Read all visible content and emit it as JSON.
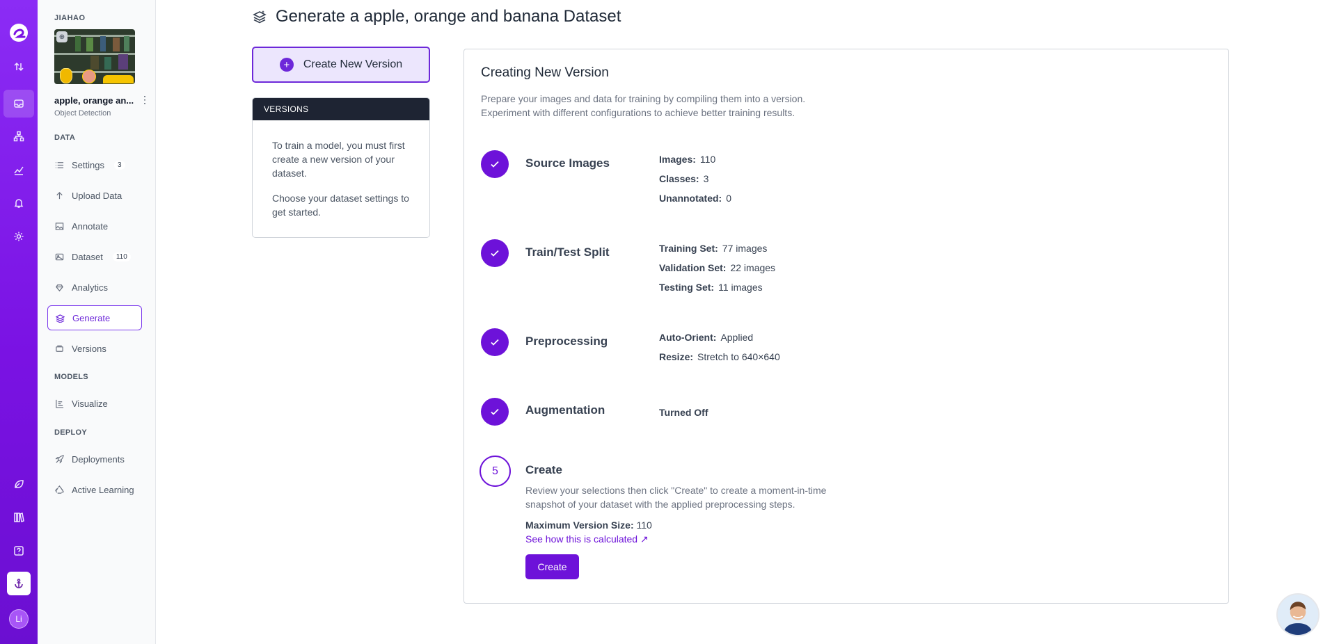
{
  "rail": {
    "items": [
      "logo-icon",
      "upload-download-icon",
      "inbox-icon",
      "workflow-icon",
      "chart-icon",
      "bell-icon",
      "gear-icon",
      "leaf-icon",
      "books-icon",
      "help-icon",
      "anchor-icon"
    ],
    "user_initials": "Li"
  },
  "sidebar": {
    "workspace": "JIAHAO",
    "project_name": "apple, orange an...",
    "project_type": "Object Detection",
    "section_data": "DATA",
    "section_models": "MODELS",
    "section_deploy": "DEPLOY",
    "items": [
      {
        "label": "Settings",
        "badge": "3",
        "icon": "list-icon"
      },
      {
        "label": "Upload Data",
        "icon": "arrow-up-icon"
      },
      {
        "label": "Annotate",
        "icon": "image-edit-icon"
      },
      {
        "label": "Dataset",
        "badge": "110",
        "icon": "images-icon"
      },
      {
        "label": "Analytics",
        "icon": "diamond-heart-icon"
      },
      {
        "label": "Generate",
        "icon": "layers-icon",
        "active": true
      },
      {
        "label": "Versions",
        "icon": "stack-icon"
      },
      {
        "label": "Visualize",
        "icon": "bars-icon"
      },
      {
        "label": "Deployments",
        "icon": "rocket-icon"
      },
      {
        "label": "Active Learning",
        "icon": "recycle-icon"
      }
    ]
  },
  "main": {
    "title": "Generate a apple, orange and banana Dataset",
    "create_new_version": "Create New Version",
    "versions": {
      "header": "VERSIONS",
      "p1": "To train a model, you must first create a new version of your dataset.",
      "p2": "Choose your dataset settings to get started."
    },
    "panel": {
      "title": "Creating New Version",
      "desc1": "Prepare your images and data for training by compiling them into a version.",
      "desc2": "Experiment with different configurations to achieve better training results.",
      "steps": [
        {
          "title": "Source Images",
          "rows": [
            {
              "label": "Images:",
              "value": "110"
            },
            {
              "label": "Classes:",
              "value": "3"
            },
            {
              "label": "Unannotated:",
              "value": "0"
            }
          ]
        },
        {
          "title": "Train/Test Split",
          "rows": [
            {
              "label": "Training Set:",
              "value": "77 images"
            },
            {
              "label": "Validation Set:",
              "value": "22 images"
            },
            {
              "label": "Testing Set:",
              "value": "11 images"
            }
          ]
        },
        {
          "title": "Preprocessing",
          "rows": [
            {
              "label": "Auto-Orient:",
              "value": "Applied"
            },
            {
              "label": "Resize:",
              "value": "Stretch to 640×640"
            }
          ]
        },
        {
          "title": "Augmentation",
          "value": "Turned Off"
        }
      ],
      "create": {
        "number": "5",
        "title": "Create",
        "desc": "Review your selections then click \"Create\" to create a moment-in-time snapshot of your dataset with the applied preprocessing steps.",
        "max_label": "Maximum Version Size:",
        "max_value": "110",
        "link": "See how this is calculated ↗",
        "button": "Create"
      }
    }
  },
  "colors": {
    "accent": "#6d12d9",
    "rail": "#7a12e3",
    "versions_header": "#1e2433"
  }
}
